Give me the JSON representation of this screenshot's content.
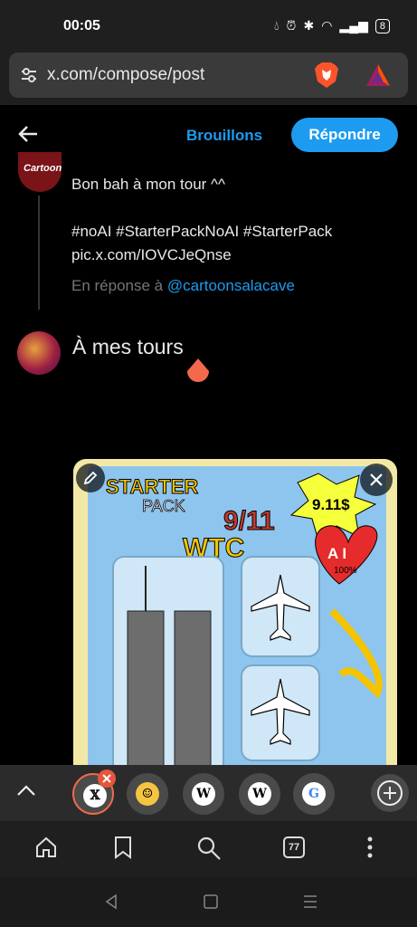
{
  "status": {
    "time": "00:05",
    "battery": "8"
  },
  "browser": {
    "url": "x.com/compose/post",
    "tab_count": "77"
  },
  "header": {
    "drafts_label": "Brouillons",
    "reply_label": "Répondre"
  },
  "original_post": {
    "lines": [
      "Bon bah à mon tour ^^",
      "",
      "#noAI #StarterPackNoAI #StarterPack",
      "pic.x.com/IOVCJeQnse"
    ],
    "reply_prefix": "En réponse à ",
    "reply_handle": "@cartoonsalacave"
  },
  "compose": {
    "text": "À mes tours"
  },
  "media_art": {
    "title_lines": [
      "STARTER",
      "PACK"
    ],
    "date": "9/11",
    "wtc": "WTC",
    "price": "9.11$",
    "heart_text": "A I",
    "heart_sub": "100%"
  },
  "colors": {
    "accent": "#1d9bf0",
    "background": "#000000"
  }
}
